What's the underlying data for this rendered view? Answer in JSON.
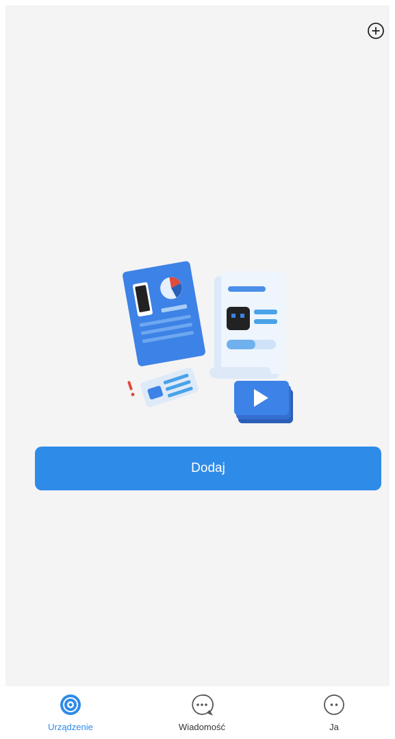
{
  "header": {
    "add_icon": "plus-circle-icon"
  },
  "empty_state": {
    "illustration": "devices-illustration",
    "button_label": "Dodaj"
  },
  "tabbar": {
    "active_color": "#2f8be8",
    "items": [
      {
        "label": "Urządzenie",
        "icon": "camera-lens-icon",
        "active": true
      },
      {
        "label": "Wiadomość",
        "icon": "chat-bubble-icon",
        "active": false
      },
      {
        "label": "Ja",
        "icon": "smiley-icon",
        "active": false
      }
    ]
  }
}
